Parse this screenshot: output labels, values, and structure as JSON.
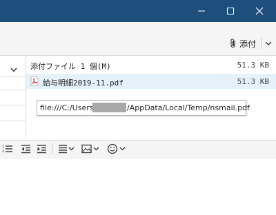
{
  "window": {
    "titlebar_color": "#1e4f7c",
    "controls": [
      "minimize-icon",
      "maximize-icon",
      "close-icon"
    ]
  },
  "toolbar": {
    "attach_label": "添付"
  },
  "attachments": {
    "header_label": "添付ファイル 1 個(M)",
    "header_size": "51.3 KB",
    "items": [
      {
        "name": "給与明細2019-11.pdf",
        "size": "51.3 KB",
        "icon": "pdf-icon"
      }
    ]
  },
  "tooltip": {
    "path_prefix": "file:///C:/Users/",
    "path_suffix": "/AppData/Local/Temp/nsmail.pdf"
  },
  "format_toolbar": {
    "buttons": [
      "numbered-list-icon",
      "outdent-icon",
      "indent-icon",
      "align-icon",
      "insert-image-icon",
      "emoji-icon"
    ]
  }
}
